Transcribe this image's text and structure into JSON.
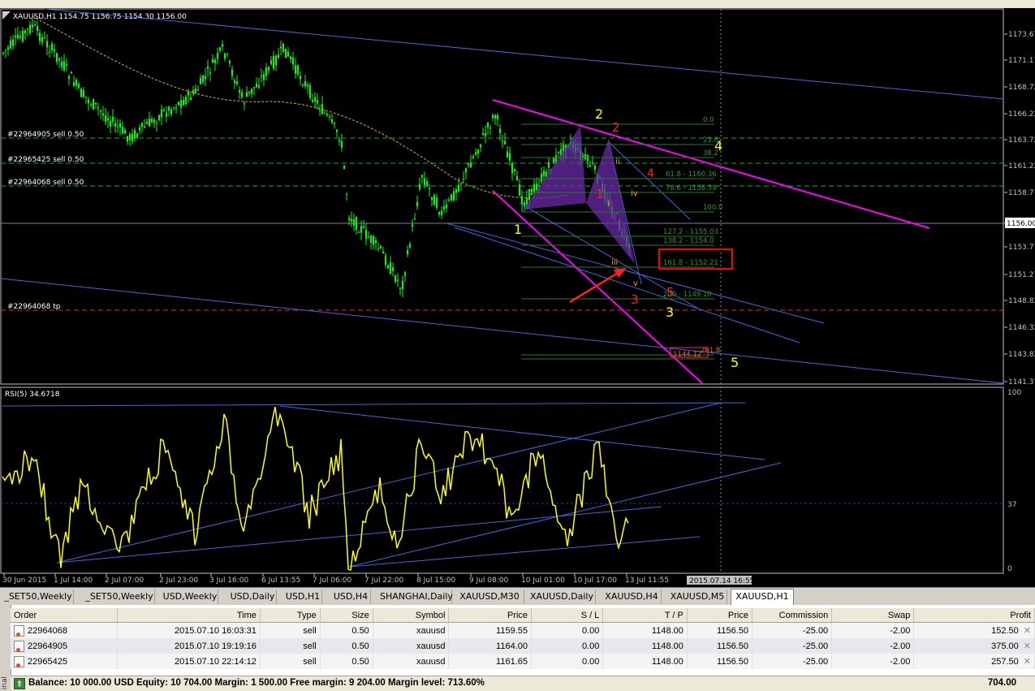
{
  "chart": {
    "header": "XAUUSD,H1  1154.75 1156.75 1154.30 1156.00",
    "rsi_label": "RSI(5) 34.6718",
    "price_labels": [
      "1173.67",
      "1171.17",
      "1168.72",
      "1166.22",
      "1163.72",
      "1161.22",
      "1158.77",
      "1156.00",
      "1153.77",
      "1151.27",
      "1148.82",
      "1146.32",
      "1143.82",
      "1141.37"
    ],
    "current_price": "1156.00",
    "rsi_labels": [
      "100",
      "37",
      "0"
    ],
    "time_labels": [
      "30 Jun 2015",
      "1 Jul 14:00",
      "2 Jul 07:00",
      "2 Jul 23:00",
      "3 Jul 16:00",
      "6 Jul 13:55",
      "7 Jul 06:00",
      "7 Jul 22:00",
      "8 Jul 15:00",
      "9 Jul 08:00",
      "10 Jul 01:00",
      "10 Jul 17:00",
      "13 Jul 11:55"
    ],
    "cursor_time": "2015.07.14 16:55",
    "order_lines": [
      "#22964905 sell 0.50",
      "#22965425 sell 0.50",
      "#22964068 sell 0.50",
      "#22964068 tp"
    ],
    "fib_labels": [
      "0.0",
      "23.6",
      "38.2",
      "61.8 - 1160.36",
      "78.6 - 1158.39",
      "100.0",
      "127.2 - 1155.03",
      "138.2 - 1154.0",
      "161.8 - 1152.21",
      "200 - 1149.10",
      "261.8",
      "1144.12"
    ],
    "wave_labels": {
      "y1": "1",
      "y2": "2",
      "y3": "3",
      "y4": "4",
      "y5": "5",
      "r1": "1",
      "r2": "2",
      "r3": "3",
      "r4": "4",
      "r5": "5",
      "oi": "i",
      "oii": "ii",
      "oiii": "iii",
      "oiv": "iv",
      "ov": "v"
    },
    "colors": {
      "candle": "#00ff00",
      "rsi": "#ffff00",
      "channel": "#4169e1",
      "pink": "#ff00ff",
      "pattern": "#6a2aa8"
    }
  },
  "tabs": [
    "_SET50,Weekly",
    "_SET50,Weekly",
    "USD,Weekly",
    "USD,Daily",
    "USD,H1",
    "USD,H4",
    "SHANGHAI,Daily",
    "XAUUSD,M30",
    "XAUUSD,Daily",
    "XAUUSD,H4",
    "XAUUSD,M5",
    "XAUUSD,H1"
  ],
  "active_tab": "XAUUSD,H1",
  "terminal": {
    "side_label": "inal",
    "columns": [
      "Order",
      "Time",
      "Type",
      "Size",
      "Symbol",
      "Price",
      "S / L",
      "T / P",
      "Price",
      "Commission",
      "Swap",
      "Profit"
    ],
    "rows": [
      [
        "22964068",
        "2015.07.10 16:03:31",
        "sell",
        "0.50",
        "xauusd",
        "1159.55",
        "0.00",
        "1148.00",
        "1156.50",
        "-25.00",
        "-2.00",
        "152.50"
      ],
      [
        "22964905",
        "2015.07.10 19:19:16",
        "sell",
        "0.50",
        "xauusd",
        "1164.00",
        "0.00",
        "1148.00",
        "1156.50",
        "-25.00",
        "-2.00",
        "375.00"
      ],
      [
        "22965425",
        "2015.07.10 22:14:12",
        "sell",
        "0.50",
        "xauusd",
        "1161.65",
        "0.00",
        "1148.00",
        "1156.50",
        "-25.00",
        "-2.00",
        "257.50"
      ]
    ],
    "balance_text": "Balance: 10 000.00 USD  Equity: 10 704.00  Margin: 1 500.00  Free margin: 9 204.00  Margin level: 713.60%",
    "total_profit": "704.00"
  }
}
